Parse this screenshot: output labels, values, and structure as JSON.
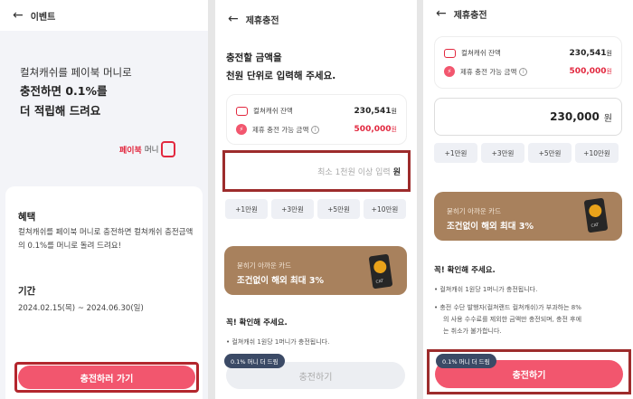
{
  "panel1": {
    "header": {
      "back_icon": "arrow-left-icon",
      "title": "이벤트"
    },
    "hero": {
      "line1": "컬쳐캐쉬를 페이북 머니로",
      "line2": "충전하면 0.1%를",
      "line3": "더 적립해 드려요"
    },
    "brand": {
      "name": "페이북",
      "money": "머니"
    },
    "benefit": {
      "title": "혜택",
      "body": "컬쳐캐쉬를 페이북 머니로 충전하면 컬쳐캐쉬 충전금액의 0.1%를 머니로 돌려 드려요!"
    },
    "period": {
      "title": "기간",
      "body": "2024.02.15(목) ~ 2024.06.30(일)"
    },
    "cta_label": "충전하러 가기"
  },
  "panel2": {
    "header": {
      "back_icon": "arrow-left-icon",
      "title": "제휴충전"
    },
    "intro": {
      "line1": "충전할 금액을",
      "line2": "천원 단위로 입력해 주세요."
    },
    "balance": {
      "label": "컬쳐캐쉬 잔액",
      "value": "230,541",
      "unit": "원",
      "avail_label": "제휴 충전 가능 금액",
      "avail_value": "500,000",
      "avail_unit": "원"
    },
    "amount_placeholder": "최소 1천원 이상 입력",
    "amount_unit": "원",
    "chips": [
      "+1만원",
      "+3만원",
      "+5만원",
      "+10만원"
    ],
    "promo": {
      "sub": "묻히기 아까운 카드",
      "title": "조건없이 해외 최대 3%"
    },
    "check": {
      "title": "꼭! 확인해 주세요.",
      "item1": "•  컬쳐캐쉬 1원당 1머니가 충전됩니다."
    },
    "tooltip": "0.1% 머니 더 드림",
    "cta_label": "충전하기"
  },
  "panel3": {
    "header": {
      "back_icon": "arrow-left-icon",
      "title": "제휴충전"
    },
    "balance": {
      "label": "컬쳐캐쉬 잔액",
      "value": "230,541",
      "unit": "원",
      "avail_label": "제휴 충전 가능 금액",
      "avail_value": "500,000",
      "avail_unit": "원"
    },
    "amount_value": "230,000",
    "amount_unit": "원",
    "chips": [
      "+1만원",
      "+3만원",
      "+5만원",
      "+10만원"
    ],
    "promo": {
      "sub": "묻히기 아까운 카드",
      "title": "조건없이 해외 최대 3%"
    },
    "check": {
      "title": "꼭! 확인해 주세요.",
      "item1": "•  컬쳐캐쉬 1원당 1머니가 충전됩니다.",
      "item2a": "•  충전 수단 발행자(컬쳐랜드 컬쳐캐쉬)가 부과하는 8%",
      "item2b": "의 사용 수수료를 제외한 금액만 충전되며, 충전 후에",
      "item2c": "는 취소가 불가합니다."
    },
    "tooltip": "0.1% 머니 더 드림",
    "cta_label": "충전하기"
  },
  "colors": {
    "accent": "#f2566e",
    "brand_red": "#e2283f",
    "promo_brown": "#a8815d",
    "highlight_border": "#9d2c2c"
  }
}
